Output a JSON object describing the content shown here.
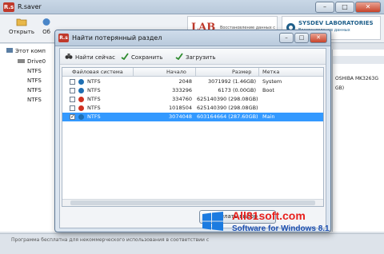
{
  "main": {
    "title": "R.saver",
    "app_icon": "R.s",
    "minimize": "–",
    "maximize": "□",
    "close": "✕",
    "toolbar": {
      "open_label": "Открыть",
      "second_label": "Об"
    },
    "banner_lab": {
      "logo": "LAB",
      "tagline": "Восстановление данных с"
    },
    "banner_sysdev": {
      "title": "SYSDEV LABORATORIES",
      "subtitle": "Восстановление данных"
    },
    "tree": {
      "root": "Этот комп",
      "drive": "Drive0",
      "items": [
        "NTFS",
        "NTFS",
        "NTFS",
        "NTFS"
      ]
    },
    "right_panel": {
      "disk": "OSHIBA MK3263G",
      "size": "GB)"
    },
    "status_text": "Программа бесплатна для некоммерческого использования в соответствии с"
  },
  "dialog": {
    "title": "Найти потерянный раздел",
    "app_icon": "R.s",
    "minimize": "–",
    "maximize": "□",
    "close": "✕",
    "toolbar": {
      "search_label": "Найти сейчас",
      "save_label": "Сохранить",
      "load_label": "Загрузить"
    },
    "columns": {
      "fs": "Файловая система",
      "start": "Начало",
      "size": "Размер",
      "label": "Метка"
    },
    "rows": [
      {
        "fs": "NTFS",
        "start": "2048",
        "size": "3071992 (1.46GB)",
        "label": "System",
        "dot": "#1f6fb2",
        "checked": false,
        "selected": false
      },
      {
        "fs": "NTFS",
        "start": "333296",
        "size": "6173 (0.00GB)",
        "label": "Boot",
        "dot": "#1f6fb2",
        "checked": false,
        "selected": false
      },
      {
        "fs": "NTFS",
        "start": "334760",
        "size": "625140390 (298.08GB)",
        "label": "",
        "dot": "#d03020",
        "checked": false,
        "selected": false
      },
      {
        "fs": "NTFS",
        "start": "1018504",
        "size": "625140390 (298.08GB)",
        "label": "",
        "dot": "#d03020",
        "checked": false,
        "selected": false
      },
      {
        "fs": "NTFS",
        "start": "3074048",
        "size": "603164664 (287.60GB)",
        "label": "Main",
        "dot": "#1f6fb2",
        "checked": true,
        "selected": true
      }
    ],
    "select_button": "Сделать выбор"
  },
  "watermark": {
    "site": "All81soft.com",
    "subtitle": "Software for Windows 8.1"
  }
}
